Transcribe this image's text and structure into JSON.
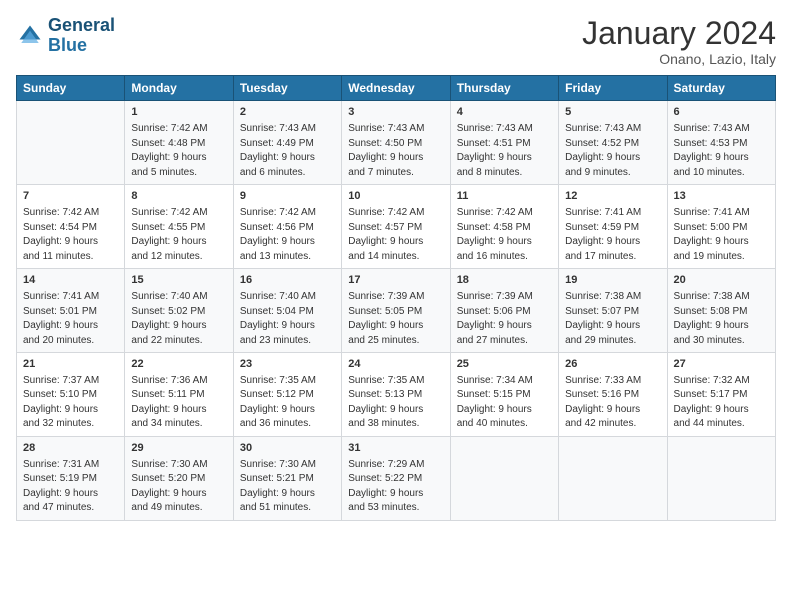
{
  "logo": {
    "line1": "General",
    "line2": "Blue"
  },
  "title": "January 2024",
  "subtitle": "Onano, Lazio, Italy",
  "headers": [
    "Sunday",
    "Monday",
    "Tuesday",
    "Wednesday",
    "Thursday",
    "Friday",
    "Saturday"
  ],
  "weeks": [
    [
      {
        "day": "",
        "content": ""
      },
      {
        "day": "1",
        "content": "Sunrise: 7:42 AM\nSunset: 4:48 PM\nDaylight: 9 hours\nand 5 minutes."
      },
      {
        "day": "2",
        "content": "Sunrise: 7:43 AM\nSunset: 4:49 PM\nDaylight: 9 hours\nand 6 minutes."
      },
      {
        "day": "3",
        "content": "Sunrise: 7:43 AM\nSunset: 4:50 PM\nDaylight: 9 hours\nand 7 minutes."
      },
      {
        "day": "4",
        "content": "Sunrise: 7:43 AM\nSunset: 4:51 PM\nDaylight: 9 hours\nand 8 minutes."
      },
      {
        "day": "5",
        "content": "Sunrise: 7:43 AM\nSunset: 4:52 PM\nDaylight: 9 hours\nand 9 minutes."
      },
      {
        "day": "6",
        "content": "Sunrise: 7:43 AM\nSunset: 4:53 PM\nDaylight: 9 hours\nand 10 minutes."
      }
    ],
    [
      {
        "day": "7",
        "content": "Sunrise: 7:42 AM\nSunset: 4:54 PM\nDaylight: 9 hours\nand 11 minutes."
      },
      {
        "day": "8",
        "content": "Sunrise: 7:42 AM\nSunset: 4:55 PM\nDaylight: 9 hours\nand 12 minutes."
      },
      {
        "day": "9",
        "content": "Sunrise: 7:42 AM\nSunset: 4:56 PM\nDaylight: 9 hours\nand 13 minutes."
      },
      {
        "day": "10",
        "content": "Sunrise: 7:42 AM\nSunset: 4:57 PM\nDaylight: 9 hours\nand 14 minutes."
      },
      {
        "day": "11",
        "content": "Sunrise: 7:42 AM\nSunset: 4:58 PM\nDaylight: 9 hours\nand 16 minutes."
      },
      {
        "day": "12",
        "content": "Sunrise: 7:41 AM\nSunset: 4:59 PM\nDaylight: 9 hours\nand 17 minutes."
      },
      {
        "day": "13",
        "content": "Sunrise: 7:41 AM\nSunset: 5:00 PM\nDaylight: 9 hours\nand 19 minutes."
      }
    ],
    [
      {
        "day": "14",
        "content": "Sunrise: 7:41 AM\nSunset: 5:01 PM\nDaylight: 9 hours\nand 20 minutes."
      },
      {
        "day": "15",
        "content": "Sunrise: 7:40 AM\nSunset: 5:02 PM\nDaylight: 9 hours\nand 22 minutes."
      },
      {
        "day": "16",
        "content": "Sunrise: 7:40 AM\nSunset: 5:04 PM\nDaylight: 9 hours\nand 23 minutes."
      },
      {
        "day": "17",
        "content": "Sunrise: 7:39 AM\nSunset: 5:05 PM\nDaylight: 9 hours\nand 25 minutes."
      },
      {
        "day": "18",
        "content": "Sunrise: 7:39 AM\nSunset: 5:06 PM\nDaylight: 9 hours\nand 27 minutes."
      },
      {
        "day": "19",
        "content": "Sunrise: 7:38 AM\nSunset: 5:07 PM\nDaylight: 9 hours\nand 29 minutes."
      },
      {
        "day": "20",
        "content": "Sunrise: 7:38 AM\nSunset: 5:08 PM\nDaylight: 9 hours\nand 30 minutes."
      }
    ],
    [
      {
        "day": "21",
        "content": "Sunrise: 7:37 AM\nSunset: 5:10 PM\nDaylight: 9 hours\nand 32 minutes."
      },
      {
        "day": "22",
        "content": "Sunrise: 7:36 AM\nSunset: 5:11 PM\nDaylight: 9 hours\nand 34 minutes."
      },
      {
        "day": "23",
        "content": "Sunrise: 7:35 AM\nSunset: 5:12 PM\nDaylight: 9 hours\nand 36 minutes."
      },
      {
        "day": "24",
        "content": "Sunrise: 7:35 AM\nSunset: 5:13 PM\nDaylight: 9 hours\nand 38 minutes."
      },
      {
        "day": "25",
        "content": "Sunrise: 7:34 AM\nSunset: 5:15 PM\nDaylight: 9 hours\nand 40 minutes."
      },
      {
        "day": "26",
        "content": "Sunrise: 7:33 AM\nSunset: 5:16 PM\nDaylight: 9 hours\nand 42 minutes."
      },
      {
        "day": "27",
        "content": "Sunrise: 7:32 AM\nSunset: 5:17 PM\nDaylight: 9 hours\nand 44 minutes."
      }
    ],
    [
      {
        "day": "28",
        "content": "Sunrise: 7:31 AM\nSunset: 5:19 PM\nDaylight: 9 hours\nand 47 minutes."
      },
      {
        "day": "29",
        "content": "Sunrise: 7:30 AM\nSunset: 5:20 PM\nDaylight: 9 hours\nand 49 minutes."
      },
      {
        "day": "30",
        "content": "Sunrise: 7:30 AM\nSunset: 5:21 PM\nDaylight: 9 hours\nand 51 minutes."
      },
      {
        "day": "31",
        "content": "Sunrise: 7:29 AM\nSunset: 5:22 PM\nDaylight: 9 hours\nand 53 minutes."
      },
      {
        "day": "",
        "content": ""
      },
      {
        "day": "",
        "content": ""
      },
      {
        "day": "",
        "content": ""
      }
    ]
  ]
}
